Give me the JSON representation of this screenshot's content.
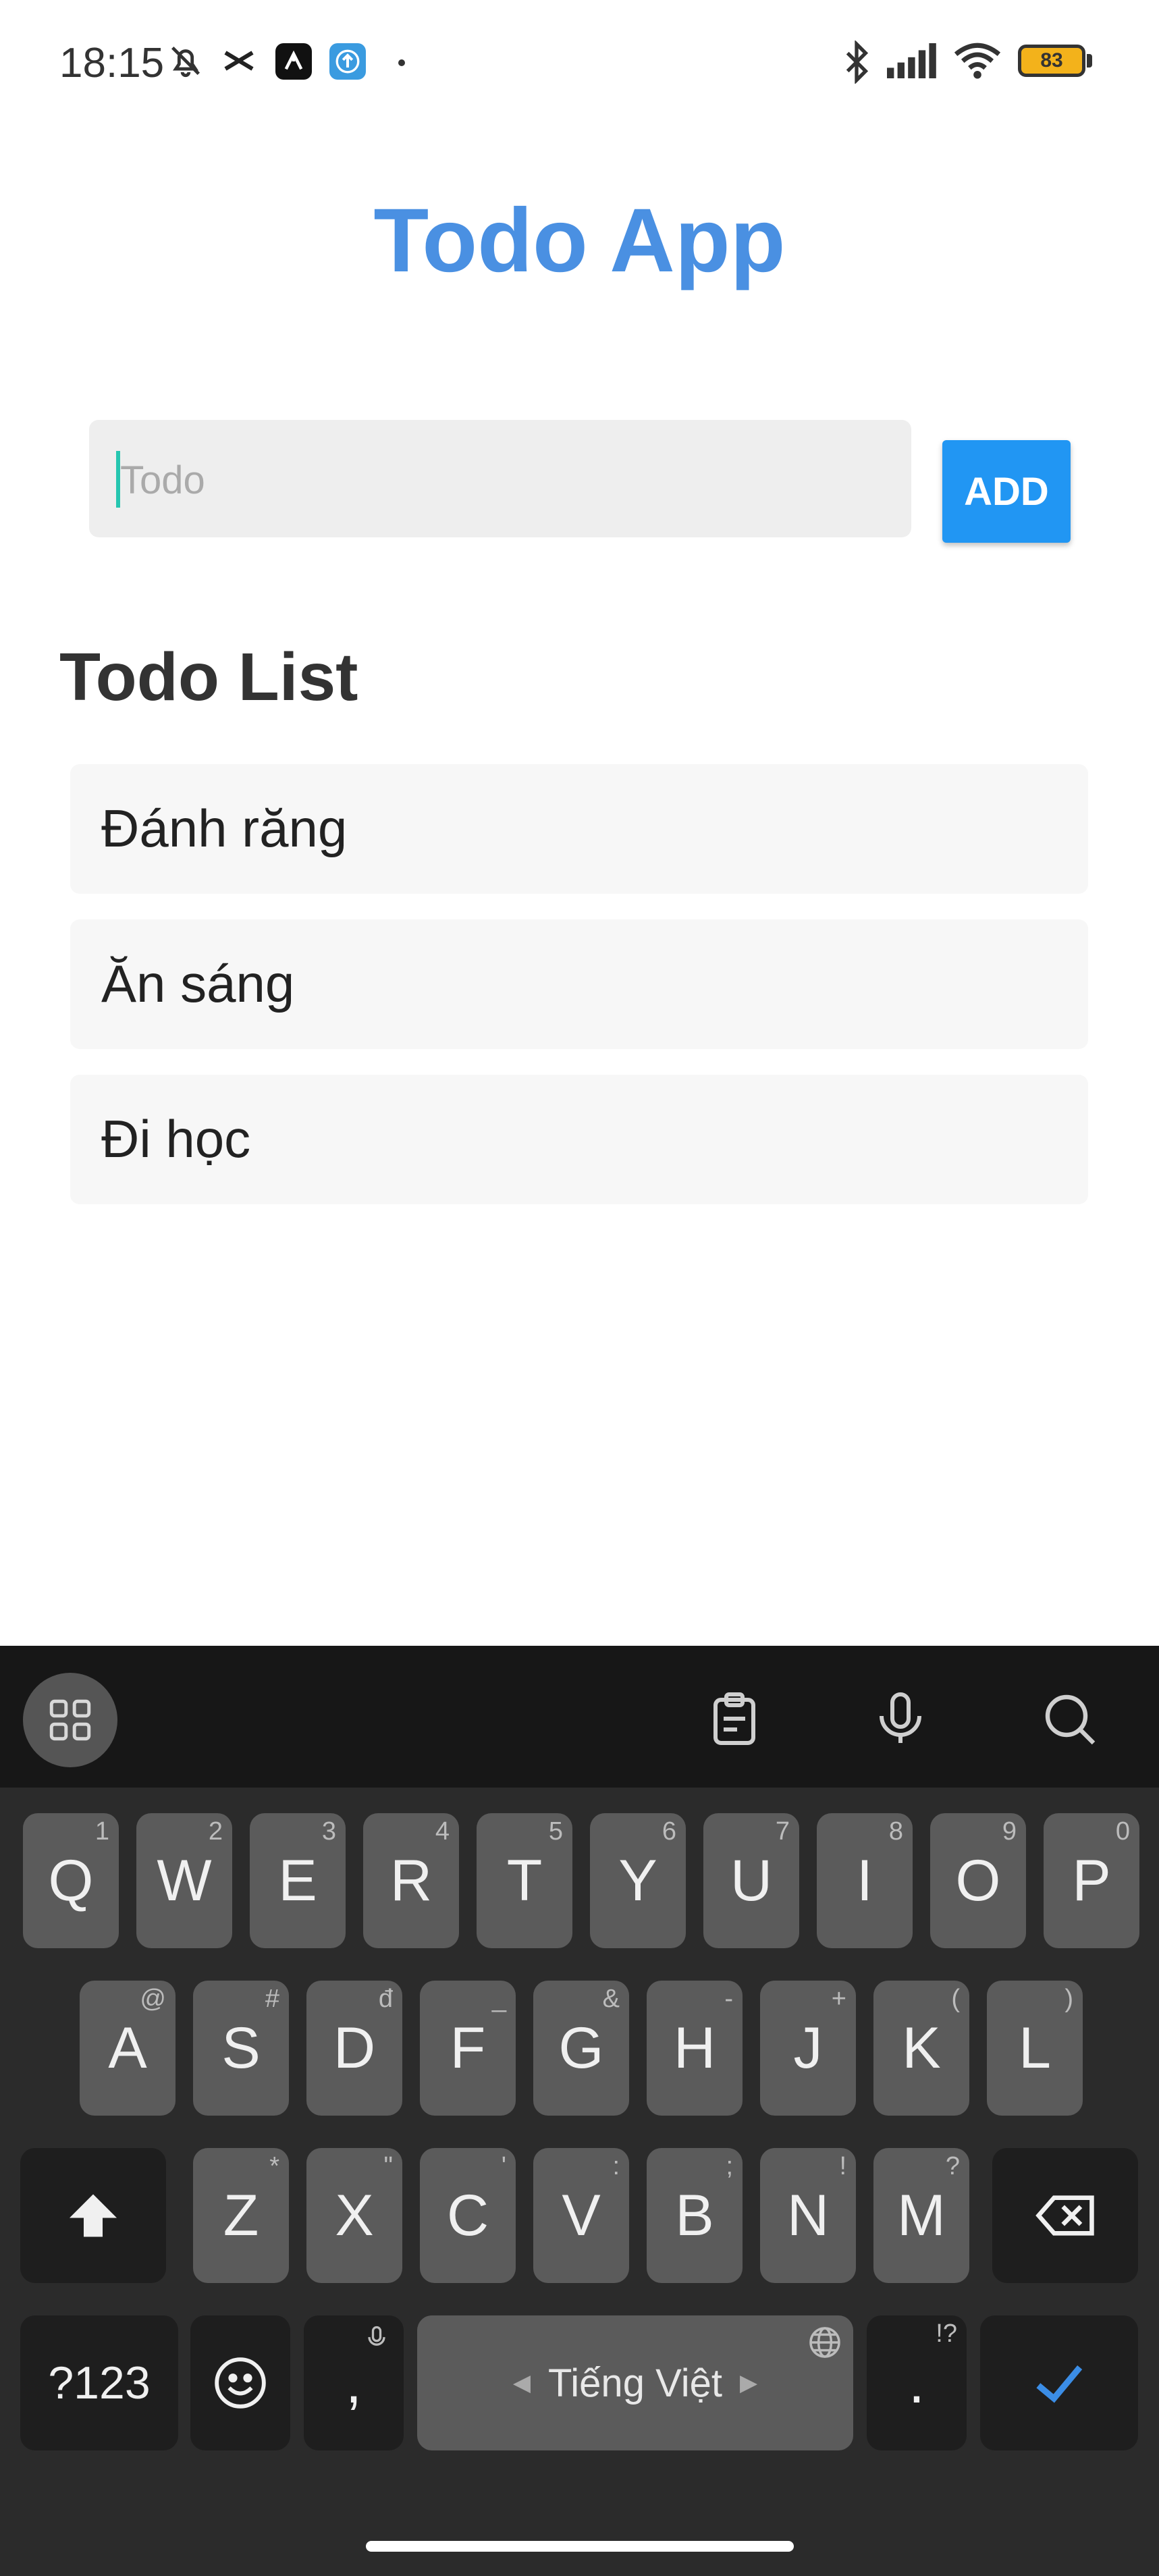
{
  "status_bar": {
    "time": "18:15",
    "battery": "83",
    "icons": [
      "bell-off-icon",
      "capcut-icon",
      "app-icon",
      "upload-icon",
      "dot-icon",
      "bluetooth-icon",
      "signal-icon",
      "wifi-icon",
      "battery-icon"
    ]
  },
  "app": {
    "title": "Todo App",
    "input_placeholder": "Todo",
    "add_button": "ADD",
    "list_title": "Todo List",
    "todos": [
      "Đánh răng",
      "Ăn sáng",
      "Đi học"
    ]
  },
  "keyboard": {
    "toolbar": [
      "grid-icon",
      "clipboard-icon",
      "microphone-icon",
      "search-icon"
    ],
    "row1": [
      {
        "key": "Q",
        "hint": "1"
      },
      {
        "key": "W",
        "hint": "2"
      },
      {
        "key": "E",
        "hint": "3"
      },
      {
        "key": "R",
        "hint": "4"
      },
      {
        "key": "T",
        "hint": "5"
      },
      {
        "key": "Y",
        "hint": "6"
      },
      {
        "key": "U",
        "hint": "7"
      },
      {
        "key": "I",
        "hint": "8"
      },
      {
        "key": "O",
        "hint": "9"
      },
      {
        "key": "P",
        "hint": "0"
      }
    ],
    "row2": [
      {
        "key": "A",
        "hint": "@"
      },
      {
        "key": "S",
        "hint": "#"
      },
      {
        "key": "D",
        "hint": "đ"
      },
      {
        "key": "F",
        "hint": "_"
      },
      {
        "key": "G",
        "hint": "&"
      },
      {
        "key": "H",
        "hint": "-"
      },
      {
        "key": "J",
        "hint": "+"
      },
      {
        "key": "K",
        "hint": "("
      },
      {
        "key": "L",
        "hint": ")"
      }
    ],
    "row3": [
      {
        "key": "Z",
        "hint": "*"
      },
      {
        "key": "X",
        "hint": "\""
      },
      {
        "key": "C",
        "hint": "'"
      },
      {
        "key": "V",
        "hint": ":"
      },
      {
        "key": "B",
        "hint": ";"
      },
      {
        "key": "N",
        "hint": "!"
      },
      {
        "key": "M",
        "hint": "?"
      }
    ],
    "symbols_key": "?123",
    "comma_key": ",",
    "period_key": ".",
    "period_hint": "!?",
    "space_label": "Tiếng Việt"
  }
}
